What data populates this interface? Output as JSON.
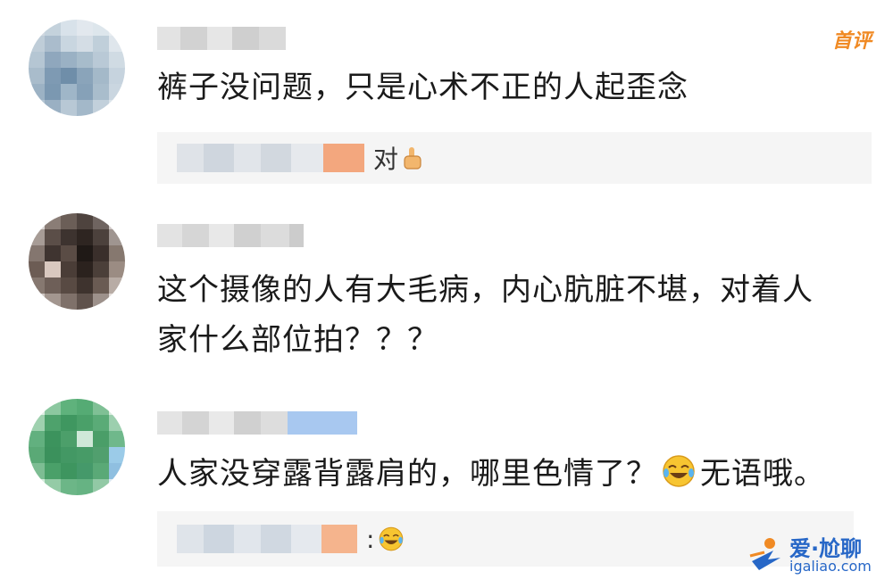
{
  "comments": [
    {
      "badge": "首评",
      "text": "裤子没问题，只是心术不正的人起歪念",
      "reply": {
        "text": "对"
      }
    },
    {
      "text": "这个摄像的人有大毛病，内心肮脏不堪，对着人家什么部位拍？？？",
      "text_line1": "这个摄像的人有大毛病，内心肮脏不堪，对着人",
      "text_line2": "家什么部位拍？？？"
    },
    {
      "text_before_emoji": "人家没穿露背露肩的，哪里色情了？",
      "text_after_emoji": "无语哦。",
      "reply": {
        "text": ":"
      }
    }
  ],
  "watermark": {
    "top": "爱·尬聊",
    "bottom": "igaliao.com"
  },
  "icons": [
    "thumbs-up-icon",
    "laughing-crying-emoji-icon"
  ],
  "colors": {
    "badge": "#f08a24",
    "watermark": "#2767c7",
    "reply_bg": "#f5f5f5"
  }
}
